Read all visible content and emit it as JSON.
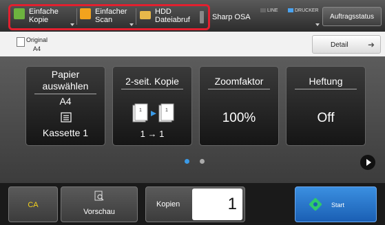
{
  "header": {
    "tabs": [
      {
        "line1": "Einfache",
        "line2": "Kopie",
        "icon": "copy-icon"
      },
      {
        "line1": "Einfacher",
        "line2": "Scan",
        "icon": "scan-icon"
      },
      {
        "line1": "HDD",
        "line2": "Dateiabruf",
        "icon": "folder-icon"
      }
    ],
    "sharp_osa": "Sharp OSA",
    "status_line": "LINE",
    "status_printer": "DRUCKER",
    "job_status": "Auftragsstatus",
    "highlight_color": "#e2202f"
  },
  "info": {
    "original_label": "Original",
    "original_value": "A4",
    "detail_label": "Detail"
  },
  "cards": [
    {
      "title_line1": "Papier",
      "title_line2": "auswählen",
      "value": "A4",
      "sub": "Kassette 1",
      "icon": "paper-tray-icon"
    },
    {
      "title": "2-seit. Kopie",
      "sub": "1 → 1",
      "icon": "duplex-copy-icon"
    },
    {
      "title": "Zoomfaktor",
      "value": "100%"
    },
    {
      "title": "Heftung",
      "value": "Off"
    }
  ],
  "pager": {
    "pages": 2,
    "active": 1
  },
  "bottom": {
    "ca_label": "CA",
    "preview_label": "Vorschau",
    "copies_label": "Kopien",
    "copies_value": "1",
    "start_label": "Start",
    "start_color": "#2f80d8"
  }
}
